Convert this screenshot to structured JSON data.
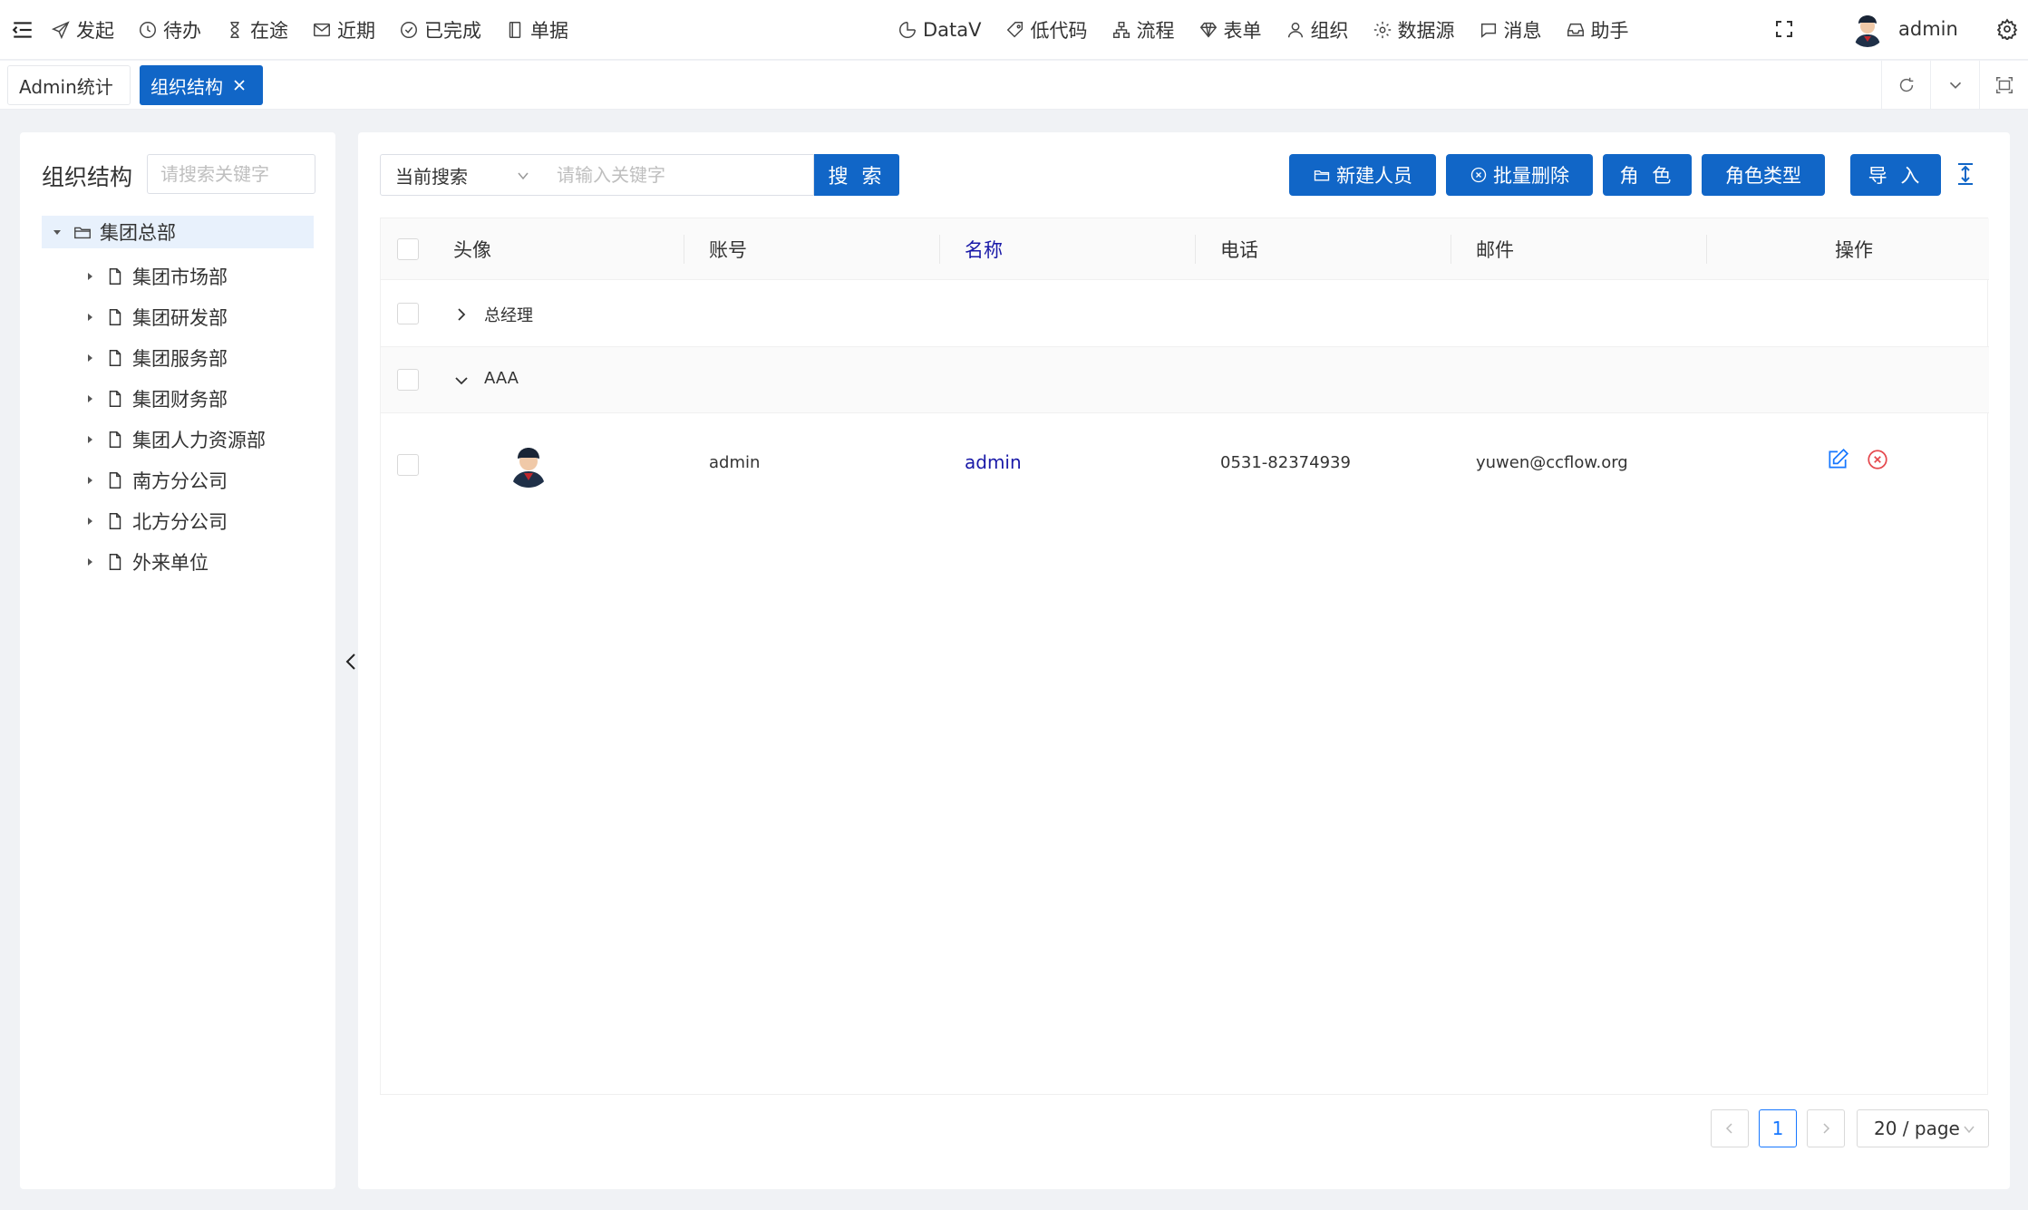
{
  "nav": {
    "left_items": [
      {
        "label": "发起",
        "icon": "send-icon"
      },
      {
        "label": "待办",
        "icon": "clock-icon"
      },
      {
        "label": "在途",
        "icon": "hourglass-icon"
      },
      {
        "label": "近期",
        "icon": "mail-icon"
      },
      {
        "label": "已完成",
        "icon": "check-circle-icon"
      },
      {
        "label": "单据",
        "icon": "document-icon"
      }
    ],
    "right_items": [
      {
        "label": "DataV",
        "icon": "dashboard-icon"
      },
      {
        "label": "低代码",
        "icon": "tag-icon"
      },
      {
        "label": "流程",
        "icon": "flow-icon"
      },
      {
        "label": "表单",
        "icon": "diamond-icon"
      },
      {
        "label": "组织",
        "icon": "user-icon"
      },
      {
        "label": "数据源",
        "icon": "gear-icon"
      },
      {
        "label": "消息",
        "icon": "message-icon"
      },
      {
        "label": "助手",
        "icon": "inbox-icon"
      }
    ],
    "user_name": "admin"
  },
  "tabs": {
    "admin_stats": "Admin统计",
    "org_structure": "组织结构"
  },
  "left": {
    "title": "组织结构",
    "search_placeholder": "请搜索关键字",
    "root": "集团总部",
    "children": [
      "集团市场部",
      "集团研发部",
      "集团服务部",
      "集团财务部",
      "集团人力资源部",
      "南方分公司",
      "北方分公司",
      "外来单位"
    ]
  },
  "toolbar": {
    "select_value": "当前搜索",
    "search_placeholder": "请输入关键字",
    "search_label": "搜 索",
    "new_label": "新建人员",
    "delete_label": "批量删除",
    "role_label": "角 色",
    "roletype_label": "角色类型",
    "import_label": "导 入"
  },
  "table": {
    "headers": {
      "avatar": "头像",
      "account": "账号",
      "name": "名称",
      "phone": "电话",
      "email": "邮件",
      "ops": "操作"
    },
    "groups": [
      {
        "label": "总经理",
        "expanded": false
      },
      {
        "label": "AAA",
        "expanded": true
      }
    ],
    "rows": [
      {
        "account": "admin",
        "name": "admin",
        "phone": "0531-82374939",
        "email": "yuwen@ccflow.org"
      }
    ]
  },
  "pager": {
    "current": "1",
    "page_size": "20 / page"
  },
  "colors": {
    "primary": "#1166c7",
    "name_link": "#1a1aa8",
    "delete_red": "#e5484d"
  }
}
